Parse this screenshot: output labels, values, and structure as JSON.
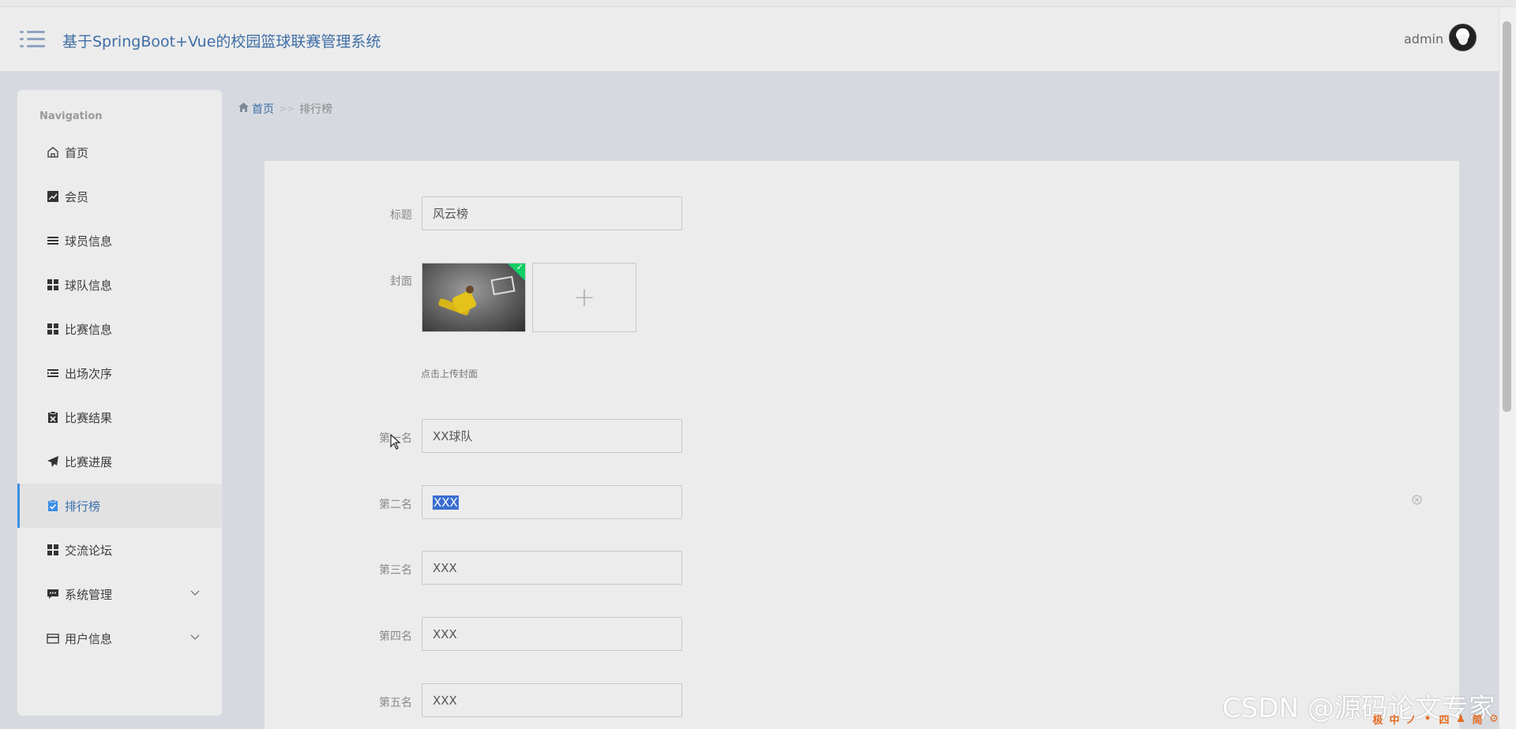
{
  "header": {
    "title": "基于SpringBoot+Vue的校园篮球联赛管理系统",
    "user": "admin"
  },
  "sidebar": {
    "heading": "Navigation",
    "items": [
      {
        "label": "首页",
        "icon": "home-icon"
      },
      {
        "label": "会员",
        "icon": "chart-icon"
      },
      {
        "label": "球员信息",
        "icon": "list-icon"
      },
      {
        "label": "球队信息",
        "icon": "grid-icon"
      },
      {
        "label": "比赛信息",
        "icon": "grid-icon"
      },
      {
        "label": "出场次序",
        "icon": "indent-icon"
      },
      {
        "label": "比赛结果",
        "icon": "clipboard-x-icon"
      },
      {
        "label": "比赛进展",
        "icon": "paper-plane-icon"
      },
      {
        "label": "排行榜",
        "icon": "clipboard-check-icon",
        "active": true
      },
      {
        "label": "交流论坛",
        "icon": "grid-icon"
      },
      {
        "label": "系统管理",
        "icon": "chat-icon",
        "expandable": true
      },
      {
        "label": "用户信息",
        "icon": "card-icon",
        "expandable": true
      }
    ]
  },
  "breadcrumb": {
    "home": "首页",
    "separator": ">>",
    "current": "排行榜"
  },
  "form": {
    "title_label": "标题",
    "title_value": "风云榜",
    "cover_label": "封面",
    "upload_plus": "+",
    "upload_hint": "点击上传封面",
    "rank1_label": "第一名",
    "rank1_value": "XX球队",
    "rank2_label": "第二名",
    "rank2_value": "XXX",
    "rank3_label": "第三名",
    "rank3_value": "XXX",
    "rank4_label": "第四名",
    "rank4_value": "XXX",
    "rank5_label": "第五名",
    "rank5_value": "XXX"
  },
  "watermark": "CSDN @源码论文专家",
  "tray": [
    "极",
    "中",
    "ノ",
    "•",
    "四",
    "♟",
    "简",
    "⚙"
  ],
  "colors": {
    "accent": "#3a8ee6",
    "title": "#3f6ea6",
    "success": "#13ce66"
  }
}
